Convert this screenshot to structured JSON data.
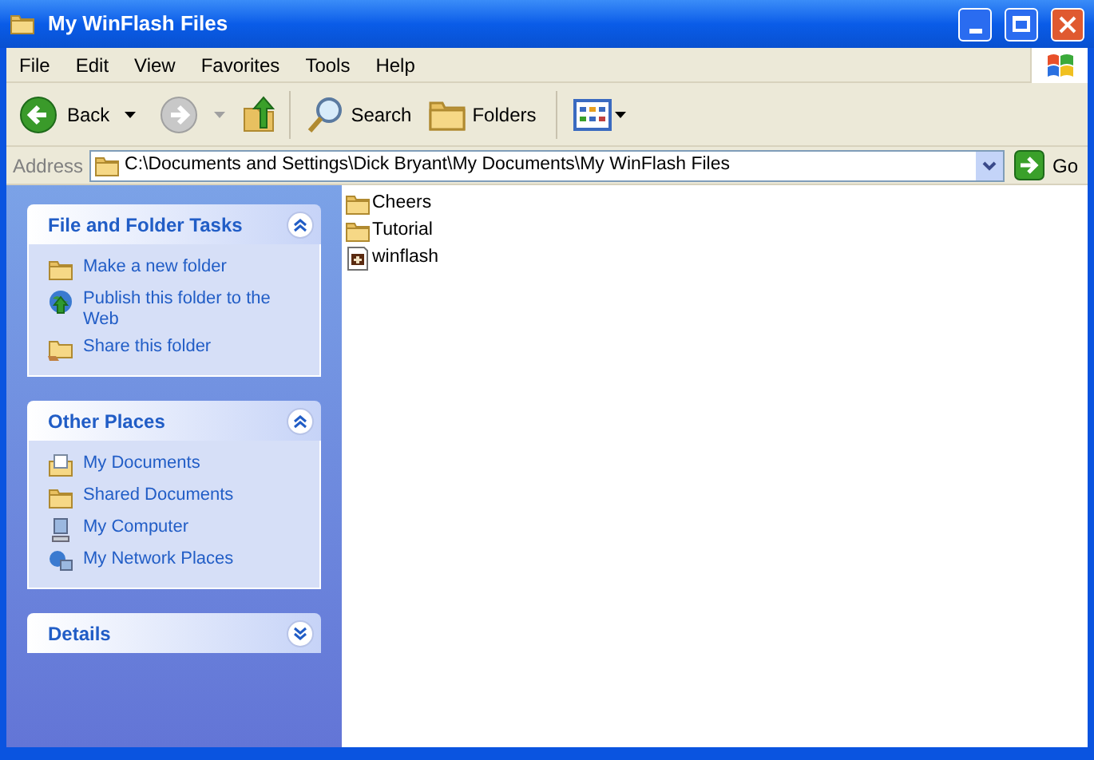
{
  "window": {
    "title": "My WinFlash Files"
  },
  "menu": [
    "File",
    "Edit",
    "View",
    "Favorites",
    "Tools",
    "Help"
  ],
  "toolbar": {
    "back": "Back",
    "search": "Search",
    "folders": "Folders"
  },
  "address": {
    "label": "Address",
    "value": "C:\\Documents and Settings\\Dick Bryant\\My Documents\\My WinFlash Files",
    "go": "Go"
  },
  "panels": [
    {
      "title": "File and Folder Tasks",
      "expanded": true,
      "items": [
        {
          "kind": "newfolder",
          "label": "Make a new folder"
        },
        {
          "kind": "publish",
          "label": "Publish this folder to the Web"
        },
        {
          "kind": "share",
          "label": "Share this folder"
        }
      ]
    },
    {
      "title": "Other Places",
      "expanded": true,
      "items": [
        {
          "kind": "documents",
          "label": "My Documents"
        },
        {
          "kind": "shared",
          "label": "Shared Documents"
        },
        {
          "kind": "computer",
          "label": "My Computer"
        },
        {
          "kind": "network",
          "label": "My Network Places"
        }
      ]
    },
    {
      "title": "Details",
      "expanded": false
    }
  ],
  "files": [
    {
      "kind": "folder",
      "name": "Cheers"
    },
    {
      "kind": "folder",
      "name": "Tutorial"
    },
    {
      "kind": "file",
      "name": "winflash"
    }
  ]
}
